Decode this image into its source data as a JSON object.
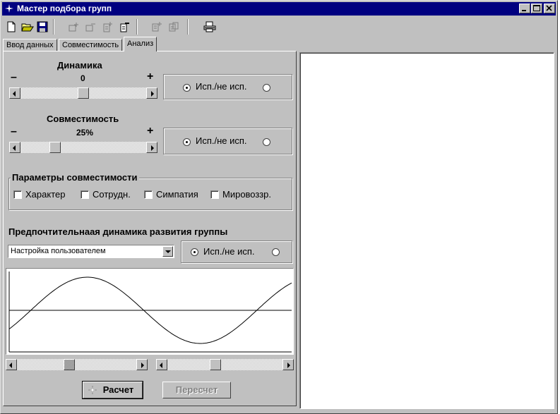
{
  "window": {
    "title": "Мастер подбора групп",
    "titlebar_color": "#000080"
  },
  "toolbar": {
    "icons": [
      "new-file-icon",
      "open-folder-icon",
      "save-icon",
      "add-group-icon",
      "remove-group-icon",
      "add-item-icon",
      "remove-item-icon",
      "copy-icon",
      "paste-icon",
      "print-icon"
    ]
  },
  "tabs": [
    {
      "label": "Ввод данных"
    },
    {
      "label": "Совместимость"
    },
    {
      "label": "Анализ",
      "active": true
    }
  ],
  "dynamics": {
    "label": "Динамика",
    "minus": "–",
    "plus": "+",
    "value": "0",
    "slider_fraction": 0.5,
    "use_label": "Исп./не исп.",
    "selected": "first"
  },
  "compatibility": {
    "label": "Совместимость",
    "minus": "–",
    "plus": "+",
    "value": "25%",
    "slider_fraction": 0.25,
    "use_label": "Исп./не исп.",
    "selected": "first"
  },
  "params": {
    "title": "Параметры совместимости",
    "items": [
      {
        "label": "Характер",
        "checked": false
      },
      {
        "label": "Сотрудн.",
        "checked": false
      },
      {
        "label": "Симпатия",
        "checked": false
      },
      {
        "label": "Мировоззр.",
        "checked": false
      }
    ]
  },
  "preferred": {
    "title": "Предпочтительнаая динамика развития группы",
    "select_value": "Настройка пользователем",
    "use_label": "Исп./не исп.",
    "selected": "first"
  },
  "buttons": {
    "calculate": "Расчет",
    "recalculate": "Пересчет"
  }
}
